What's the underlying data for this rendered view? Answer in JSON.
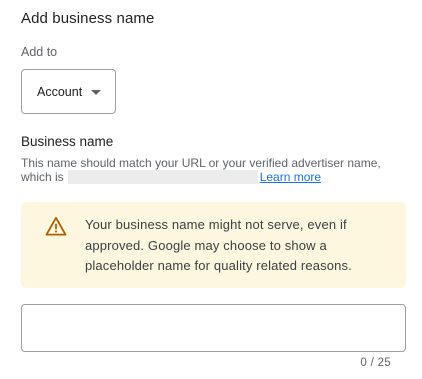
{
  "dialog": {
    "title": "Add business name"
  },
  "add_to": {
    "label": "Add to",
    "selected": "Account"
  },
  "business_name": {
    "heading": "Business name",
    "helper_line1": "This name should match your URL or your verified advertiser name,",
    "helper_line2_prefix": "which is",
    "learn_more": "Learn more"
  },
  "warning": {
    "icon": "warning-triangle-icon",
    "text": "Your business name might not serve, even if approved. Google may choose to show a placeholder name for quality related reasons.",
    "color": "#b06000",
    "background": "#fef7e0"
  },
  "input": {
    "value": "",
    "counter": "0 / 25"
  },
  "colors": {
    "link": "#1a73e8"
  }
}
